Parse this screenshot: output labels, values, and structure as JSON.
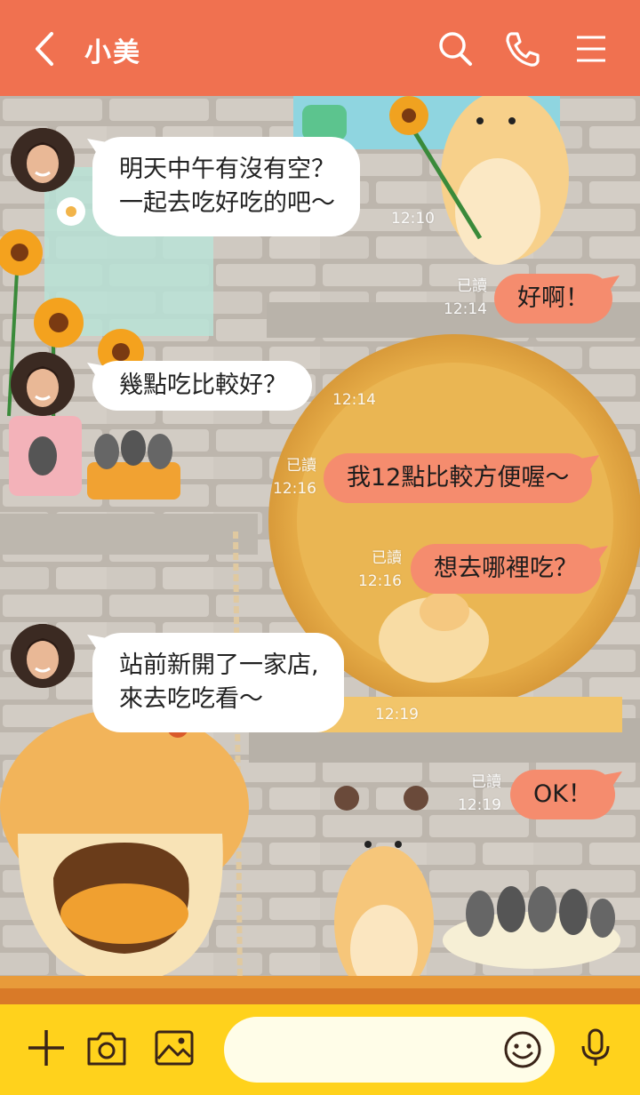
{
  "header": {
    "title": "小美",
    "back_icon": "chevron-left-icon",
    "search_icon": "search-icon",
    "call_icon": "phone-icon",
    "menu_icon": "menu-icon",
    "bg_color": "#f07150"
  },
  "messages": [
    {
      "side": "in",
      "lines": [
        "明天中午有沒有空？",
        "一起去吃好吃的吧～"
      ],
      "time": "12:10"
    },
    {
      "side": "out",
      "text": "好啊！",
      "read": "已讀",
      "time": "12:14"
    },
    {
      "side": "in",
      "text": "幾點吃比較好？",
      "time": "12:14"
    },
    {
      "side": "out",
      "text": "我12點比較方便喔～",
      "read": "已讀",
      "time": "12:16"
    },
    {
      "side": "out",
      "text": "想去哪裡吃？",
      "read": "已讀",
      "time": "12:16"
    },
    {
      "side": "in",
      "lines": [
        "站前新開了一家店,",
        "來去吃吃看～"
      ],
      "time": "12:19"
    },
    {
      "side": "out",
      "text": "OK！",
      "read": "已讀",
      "time": "12:19"
    }
  ],
  "bottombar": {
    "add_icon": "plus-icon",
    "camera_icon": "camera-icon",
    "gallery_icon": "image-icon",
    "emoji_icon": "smiley-icon",
    "mic_icon": "microphone-icon",
    "input_value": "",
    "bg_color": "#ffd21c"
  },
  "colors": {
    "outgoing_bubble": "#f58c6e",
    "incoming_bubble": "#ffffff"
  }
}
